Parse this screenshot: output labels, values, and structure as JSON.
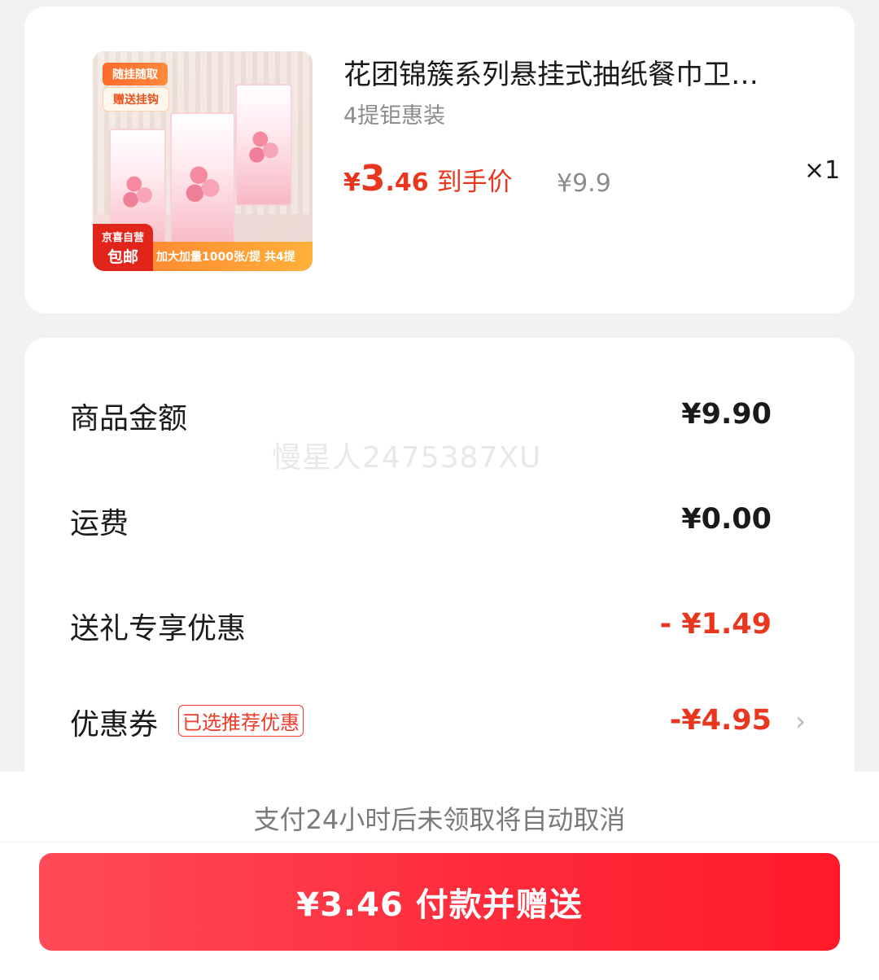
{
  "product": {
    "title": "花团锦簇系列悬挂式抽纸餐巾卫…",
    "spec": "4提钜惠装",
    "price_symbol": "¥",
    "price_int": "3",
    "price_dec": ".46",
    "price_label": "到手价",
    "original_price": "¥9.9",
    "quantity": "×1",
    "thumbnail": {
      "tag_top": "随挂随取",
      "tag_top2": "赠送挂钩",
      "self_badge_line1": "京喜自营",
      "self_badge_line2": "包邮",
      "bottom_text": "加大加量1000张/提 共4提"
    }
  },
  "summary": {
    "goods_amount_label": "商品金额",
    "goods_amount_value": "¥9.90",
    "shipping_label": "运费",
    "shipping_value": "¥0.00",
    "gift_discount_label": "送礼专享优惠",
    "gift_discount_value": "- ¥1.49",
    "coupon_label": "优惠券",
    "coupon_tag": "已选推荐优惠",
    "coupon_value": "-¥4.95"
  },
  "watermark": "慢星人2475387XU",
  "notice": "支付24小时后未领取将自动取消",
  "pay_button": "¥3.46 付款并赠送",
  "colors": {
    "accent_red": "#e8361f",
    "button_start": "#ff4a58",
    "button_end": "#ff1a2a",
    "background": "#f2f2f2"
  }
}
